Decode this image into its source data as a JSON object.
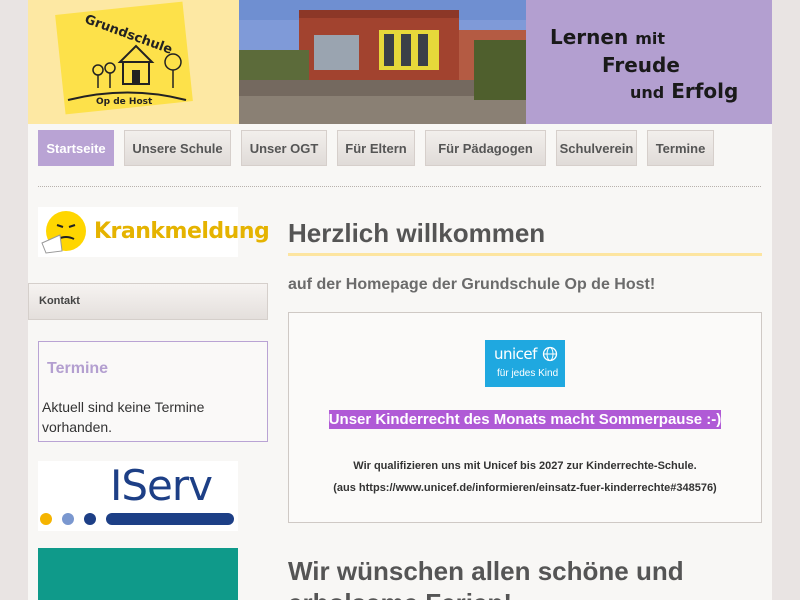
{
  "header": {
    "logo": {
      "school_name": "Grundschule",
      "school_place": "Op de Host"
    },
    "slogan": {
      "line1_a": "Lernen",
      "line1_b": "mit",
      "line2": "Freude",
      "line3_a": "und",
      "line3_b": "Erfolg"
    }
  },
  "nav": {
    "items": [
      {
        "label": "Startseite",
        "active": true
      },
      {
        "label": "Unsere Schule",
        "active": false
      },
      {
        "label": "Unser OGT",
        "active": false
      },
      {
        "label": "Für Eltern",
        "active": false
      },
      {
        "label": "Für Pädagogen",
        "active": false
      },
      {
        "label": "Schulverein",
        "active": false
      },
      {
        "label": "Termine",
        "active": false
      }
    ]
  },
  "sidebar": {
    "krankmeldung_label": "Krankmeldung",
    "kontakt_label": "Kontakt",
    "termine": {
      "title": "Termine",
      "text": "Aktuell sind keine Termine vorhanden."
    },
    "iserv_label": "IServ"
  },
  "main": {
    "heading": "Herzlich willkommen",
    "subheading": "auf der Homepage der Grundschule Op de Host!",
    "unicef": {
      "logo_name": "unicef",
      "logo_sub": "für jedes Kind",
      "highlight": "Unser Kinderrecht des Monats macht Sommerpause :-)",
      "text1": "Wir qualifizieren uns mit Unicef bis 2027 zur Kinderrechte-Schule.",
      "text2": "(aus https://www.unicef.de/informieren/einsatz-fuer-kinderrechte#348576)"
    },
    "ferien_heading": "Wir wünschen allen schöne und erholsame Ferien!"
  },
  "colors": {
    "accent_purple": "#b39fd0",
    "logo_yellow": "#fde8a3",
    "unicef_blue": "#1fa8e0",
    "highlight_purple": "#b05ad6"
  }
}
